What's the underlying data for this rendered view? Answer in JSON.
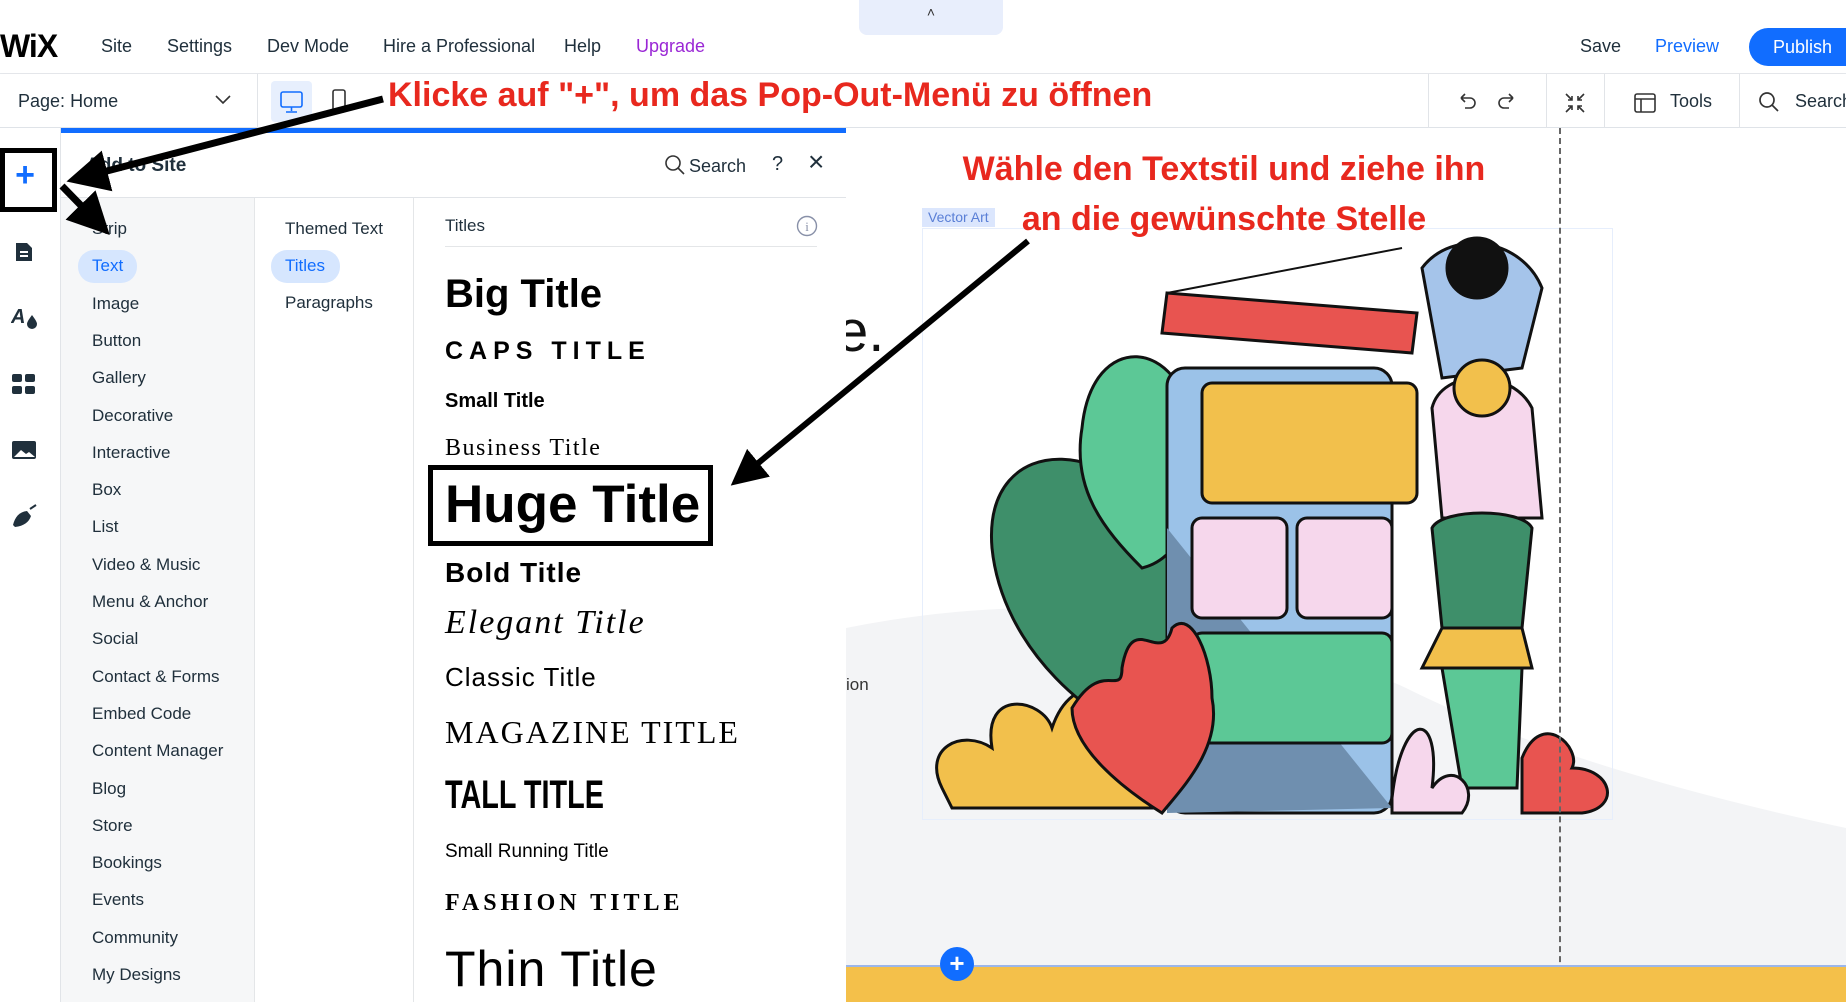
{
  "topbar": {
    "logo": "WiX",
    "menu": [
      "Site",
      "Settings",
      "Dev Mode",
      "Hire a Professional",
      "Help",
      "Upgrade"
    ],
    "handle": "˄",
    "save": "Save",
    "preview": "Preview",
    "publish": "Publish"
  },
  "toolbar": {
    "page_label": "Page:",
    "page_value": "Home",
    "tools": "Tools",
    "search": "Search"
  },
  "panel": {
    "title": "Add to Site",
    "search": "Search",
    "help": "?",
    "close": "×",
    "categories": [
      "Strip",
      "Text",
      "Image",
      "Button",
      "Gallery",
      "Decorative",
      "Interactive",
      "Box",
      "List",
      "Video & Music",
      "Menu & Anchor",
      "Social",
      "Contact & Forms",
      "Embed Code",
      "Content Manager",
      "Blog",
      "Store",
      "Bookings",
      "Events",
      "Community",
      "My Designs"
    ],
    "selected_category": "Text",
    "subcategories": [
      "Themed Text",
      "Titles",
      "Paragraphs"
    ],
    "selected_subcategory": "Titles",
    "section_title": "Titles",
    "title_styles": [
      "Big Title",
      "CAPS TITLE",
      "Small Title",
      "Business Title",
      "Huge Title",
      "Bold Title",
      "Elegant Title",
      "Classic Title",
      "MAGAZINE TITLE",
      "TALL TITLE",
      "Small Running Title",
      "FASHION TITLE",
      "Thin Title"
    ]
  },
  "canvas": {
    "partial_heading": "e.",
    "partial_text": "ion",
    "element_label": "Vector Art"
  },
  "annotations": {
    "step1": "Klicke auf \"+\", um das Pop-Out-Menü zu öffnen",
    "step2_line1": "Wähle den Textstil und ziehe ihn",
    "step2_line2": "an die gewünschte Stelle"
  },
  "colors": {
    "accent": "#116dff",
    "annotation": "#e8281e",
    "upgrade": "#9a27d5",
    "preview": "#116dff"
  }
}
